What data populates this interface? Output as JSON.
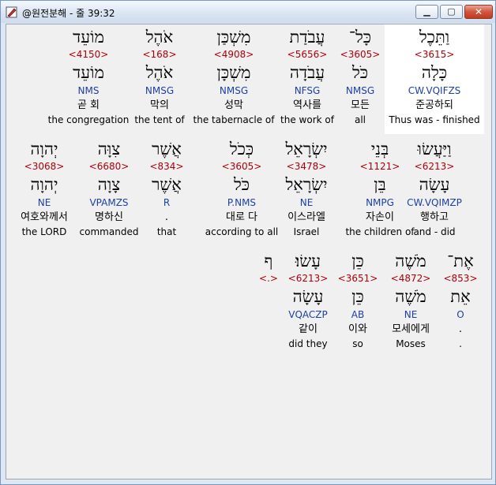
{
  "window": {
    "title": "@원전분해 - 줄 39:32"
  },
  "icons": {
    "app": "pen-icon",
    "minimize": "minimize-icon",
    "maximize": "maximize-icon",
    "close": "close-icon"
  },
  "rows": [
    [
      {
        "heb": "וַתֵּכֶל",
        "strong": "<3615>",
        "lemma": "כָּלָה",
        "parse": "CW.VQIFZS",
        "kor": "준공하되",
        "eng": "Thus was - finished",
        "highlight": true
      },
      {
        "heb": "כָּל־",
        "strong": "<3605>",
        "lemma": "כֹּל",
        "parse": "NMSG",
        "kor": "모든",
        "eng": "all"
      },
      {
        "heb": "עֲבֹדַת",
        "strong": "<5656>",
        "lemma": "עֲבֹדָה",
        "parse": "NFSG",
        "kor": "역사를",
        "eng": "the work of"
      },
      {
        "heb": "מִשְׁכַּן",
        "strong": "<4908>",
        "lemma": "מִשְׁכָּן",
        "parse": "NMSG",
        "kor": "성막",
        "eng": "the tabernacle of"
      },
      {
        "heb": "אֹהֶל",
        "strong": "<168>",
        "lemma": "אֹהֶל",
        "parse": "NMSG",
        "kor": "막의",
        "eng": "the tent of"
      },
      {
        "heb": "מוֹעֵד",
        "strong": "<4150>",
        "lemma": "מוֹעֵד",
        "parse": "NMS",
        "kor": "곧 회",
        "eng": "the congregation"
      }
    ],
    [
      {
        "heb": "וַיַּעֲשׂוּ",
        "strong": "<6213>",
        "lemma": "עָשָׂה",
        "parse": "CW.VQIMZP",
        "kor": "행하고",
        "eng": "and - did"
      },
      {
        "heb": "בְּנֵי",
        "strong": "<1121>",
        "lemma": "בֵּן",
        "parse": "NMPG",
        "kor": "자손이",
        "eng": "the children of"
      },
      {
        "heb": "יִשְׂרָאֵל",
        "strong": "<3478>",
        "lemma": "יִשְׂרָאֵל",
        "parse": "NE",
        "kor": "이스라엘",
        "eng": "Israel"
      },
      {
        "heb": "כְּכֹל",
        "strong": "<3605>",
        "lemma": "כֹּל",
        "parse": "P.NMS",
        "kor": "대로 다",
        "eng": "according to all"
      },
      {
        "heb": "אֲשֶׁר",
        "strong": "<834>",
        "lemma": "אֲשֶׁר",
        "parse": "R",
        "kor": ".",
        "eng": "that"
      },
      {
        "heb": "צִוָּה",
        "strong": "<6680>",
        "lemma": "צָוָה",
        "parse": "VPAMZS",
        "kor": "명하신",
        "eng": "commanded"
      },
      {
        "heb": "יְהוָה",
        "strong": "<3068>",
        "lemma": "יְהוָה",
        "parse": "NE",
        "kor": "여호와께서",
        "eng": "the LORD"
      }
    ],
    [
      {
        "heb": "אֶת־",
        "strong": "<853>",
        "lemma": "אֵת",
        "parse": "O",
        "kor": ".",
        "eng": "."
      },
      {
        "heb": "מֹשֶׁה",
        "strong": "<4872>",
        "lemma": "מֹשֶׁה",
        "parse": "NE",
        "kor": "모세에게",
        "eng": "Moses"
      },
      {
        "heb": "כֵּן",
        "strong": "<3651>",
        "lemma": "כֵּן",
        "parse": "AB",
        "kor": "이와",
        "eng": "so"
      },
      {
        "heb": "עָשׂוּ׃",
        "strong": "<6213>",
        "lemma": "עָשָׂה",
        "parse": "VQACZP",
        "kor": "같이",
        "eng": "did they"
      },
      {
        "heb": "ף",
        "strong": "<.>",
        "lemma": "",
        "parse": "",
        "kor": "",
        "eng": ""
      }
    ]
  ]
}
